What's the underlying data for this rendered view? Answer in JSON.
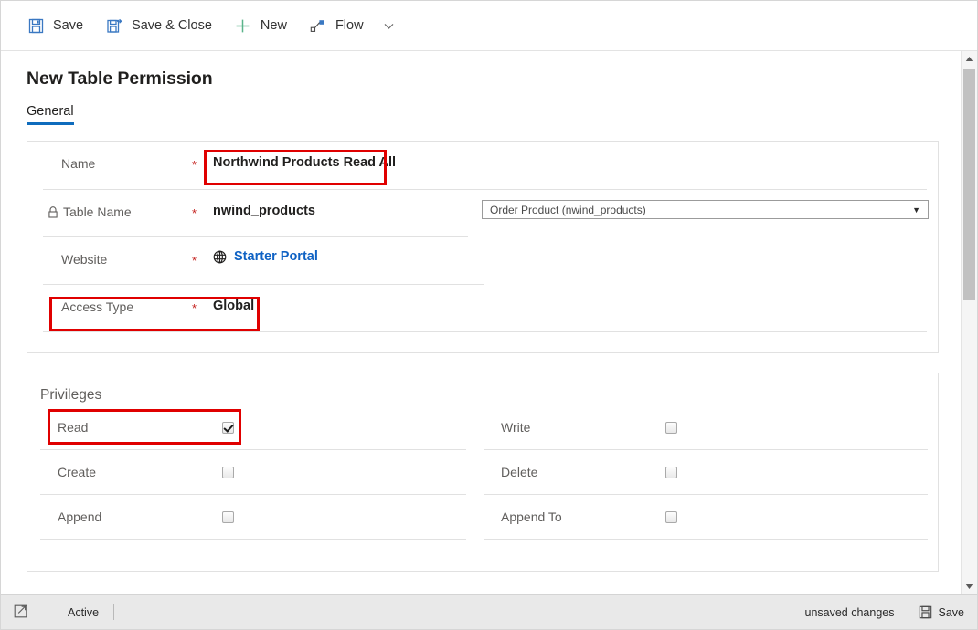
{
  "commandbar": {
    "items": [
      {
        "label": "Save",
        "icon": "save-icon"
      },
      {
        "label": "Save & Close",
        "icon": "save-and-close-icon"
      },
      {
        "label": "New",
        "icon": "plus-icon"
      },
      {
        "label": "Flow",
        "icon": "flow-icon"
      }
    ],
    "overflow_chevron": "chevron-down-icon"
  },
  "page": {
    "title": "New Table Permission"
  },
  "tabs": [
    {
      "label": "General",
      "active": true
    }
  ],
  "general": {
    "rows": [
      {
        "label": "Name",
        "required": "*",
        "value": "Northwind Products Read All",
        "locked": false
      },
      {
        "label": "Table Name",
        "required": "*",
        "value": "nwind_products",
        "locked": true
      },
      {
        "label": "Website",
        "required": "*",
        "value": "Starter Portal",
        "locked": false
      },
      {
        "label": "Access Type",
        "required": "*",
        "value": "Global",
        "locked": false
      }
    ],
    "table_dropdown": {
      "value": "Order Product (nwind_products)",
      "arrow": "▼"
    }
  },
  "privileges": {
    "title": "Privileges",
    "left_column": [
      {
        "label": "Read",
        "checked": true
      },
      {
        "label": "Create",
        "checked": false
      },
      {
        "label": "Append",
        "checked": false
      }
    ],
    "right_column": [
      {
        "label": "Write",
        "checked": false
      },
      {
        "label": "Delete",
        "checked": false
      },
      {
        "label": "Append To",
        "checked": false
      }
    ]
  },
  "statusbar": {
    "expand_icon": "popout-icon",
    "status": "Active",
    "unsaved": "unsaved changes",
    "save_label": "Save",
    "save_icon": "save-icon"
  },
  "scrollbar": {
    "up_arrow": "▲",
    "down_arrow": "▼"
  },
  "colors": {
    "accent": "#0f6cbd",
    "link": "#0f62c4",
    "required": "#c5221f",
    "highlight": "#e00000"
  }
}
